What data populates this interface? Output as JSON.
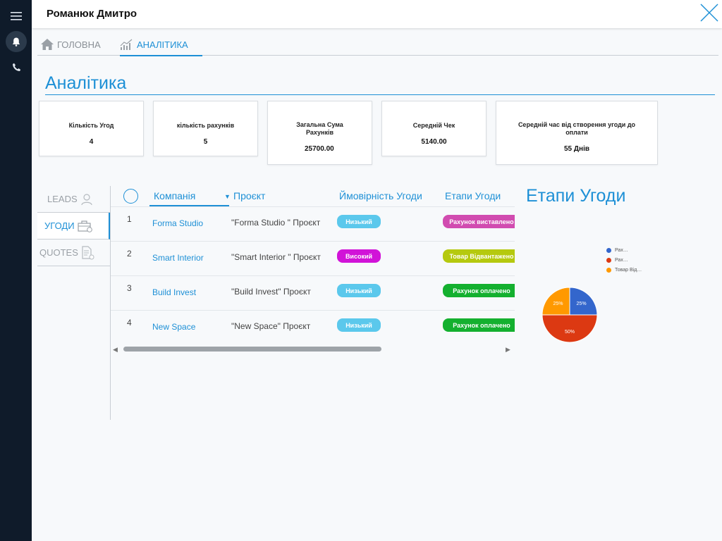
{
  "header": {
    "title": "Романюк Дмитро"
  },
  "nav": {
    "home_label": "ГОЛОВНА",
    "analytics_label": "АНАЛІТИКА"
  },
  "section_title": "Аналітика",
  "stats": [
    {
      "label": "Кількість Угод",
      "value": "4"
    },
    {
      "label": "кількість рахунків",
      "value": "5"
    },
    {
      "label": "Загальна Сума Рахунків",
      "value": "25700.00"
    },
    {
      "label": "Середній Чек",
      "value": "5140.00"
    },
    {
      "label": "Середній час від створення угоди до оплати",
      "value": "55 Днів"
    }
  ],
  "subtabs": [
    {
      "label": "LEADS",
      "active": false
    },
    {
      "label": "УГОДИ",
      "active": true
    },
    {
      "label": "QUOTES",
      "active": false
    }
  ],
  "table": {
    "headers": {
      "company": "Компанія",
      "project": "Проєкт",
      "probability": "Ймовірність Угоди",
      "stage": "Етапи Угоди"
    },
    "rows": [
      {
        "num": "1",
        "company": "Forma Studio",
        "project": "\"Forma Studio \" Проєкт",
        "probability": "Низький",
        "prob_color": "#5bc8ec",
        "stage": "Рахунок виставлено",
        "stage_color": "#d14cb0"
      },
      {
        "num": "2",
        "company": "Smart Interior",
        "project": "\"Smart Interior \" Проєкт",
        "probability": "Високий",
        "prob_color": "#d113d8",
        "stage": "Товар Відвантажено",
        "stage_color": "#b5c90f"
      },
      {
        "num": "3",
        "company": "Build Invest",
        "project": "\"Build Invest\" Проєкт",
        "probability": "Низький",
        "prob_color": "#5bc8ec",
        "stage": "Рахунок оплачено",
        "stage_color": "#14b02f"
      },
      {
        "num": "4",
        "company": "New Space",
        "project": "\"New Space\" Проєкт",
        "probability": "Низький",
        "prob_color": "#5bc8ec",
        "stage": "Рахунок оплачено",
        "stage_color": "#14b02f"
      }
    ]
  },
  "chart_data": {
    "type": "pie",
    "title": "Етапи Угоди",
    "legend_position": "right",
    "legend": [
      "Рах…",
      "Рах…",
      "Товар Від…"
    ],
    "slices": [
      {
        "label": "Рах…",
        "value": 25,
        "color": "#3366cc"
      },
      {
        "label": "Рах…",
        "value": 50,
        "color": "#dc3912"
      },
      {
        "label": "Товар Від…",
        "value": 25,
        "color": "#ff9900"
      }
    ],
    "data_labels": [
      "25%",
      "50%",
      "25%"
    ]
  }
}
